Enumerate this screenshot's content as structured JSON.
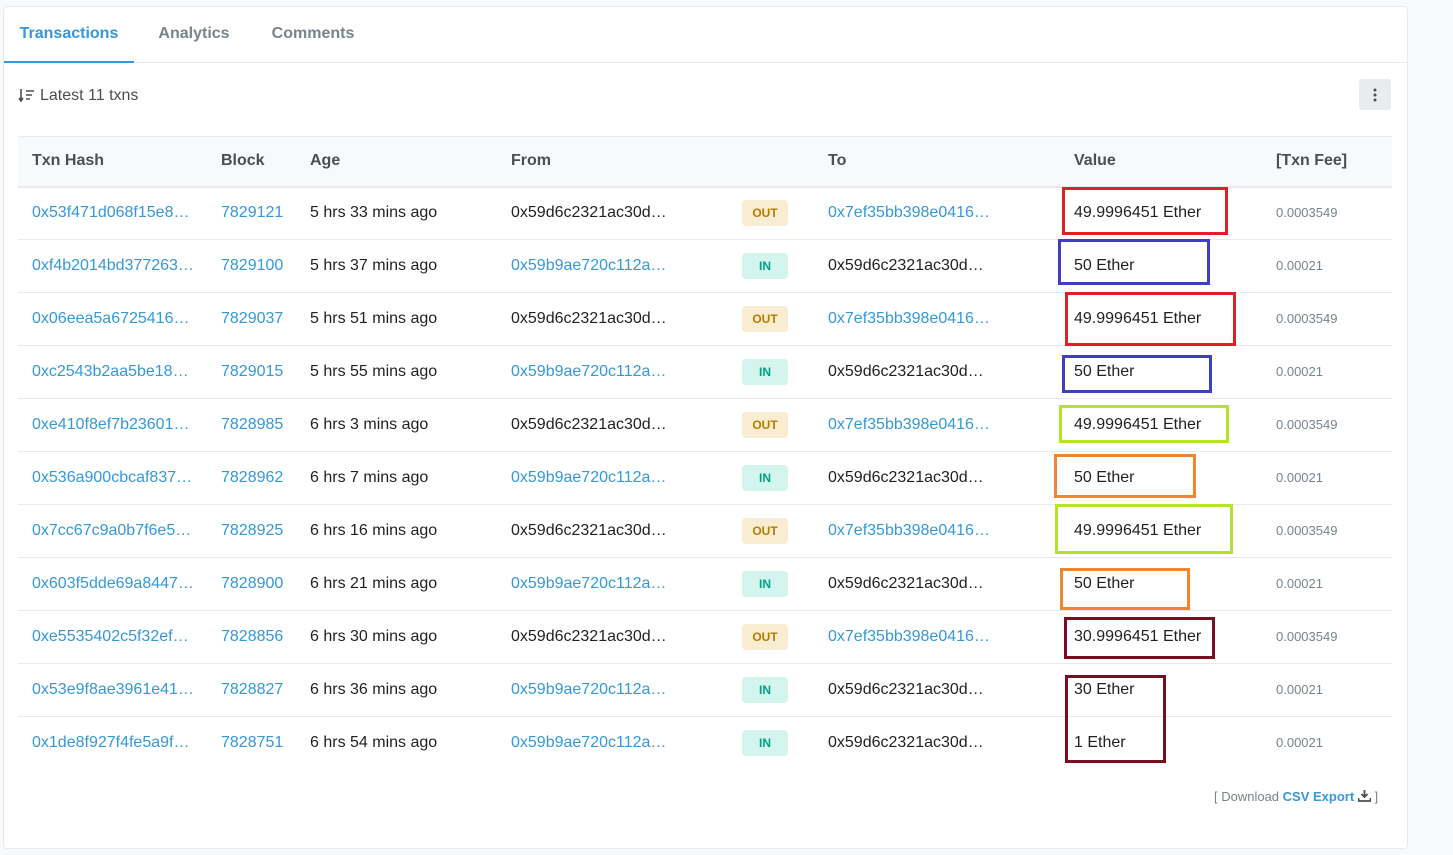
{
  "tabs": [
    {
      "label": "Transactions",
      "active": true
    },
    {
      "label": "Analytics",
      "active": false
    },
    {
      "label": "Comments",
      "active": false
    }
  ],
  "summary": {
    "latest_label": "Latest 11 txns"
  },
  "columns": [
    "Txn Hash",
    "Block",
    "Age",
    "From",
    "",
    "To",
    "Value",
    "[Txn Fee]"
  ],
  "rows": [
    {
      "hash": "0x53f471d068f15e8…",
      "block": "7829121",
      "age": "5 hrs 33 mins ago",
      "from": "0x59d6c2321ac30d…",
      "from_link": false,
      "dir": "OUT",
      "to": "0x7ef35bb398e0416…",
      "to_link": true,
      "value": "49.9996451 Ether",
      "fee": "0.0003549"
    },
    {
      "hash": "0xf4b2014bd377263…",
      "block": "7829100",
      "age": "5 hrs 37 mins ago",
      "from": "0x59b9ae720c112a…",
      "from_link": true,
      "dir": "IN",
      "to": "0x59d6c2321ac30d…",
      "to_link": false,
      "value": "50 Ether",
      "fee": "0.00021"
    },
    {
      "hash": "0x06eea5a6725416…",
      "block": "7829037",
      "age": "5 hrs 51 mins ago",
      "from": "0x59d6c2321ac30d…",
      "from_link": false,
      "dir": "OUT",
      "to": "0x7ef35bb398e0416…",
      "to_link": true,
      "value": "49.9996451 Ether",
      "fee": "0.0003549"
    },
    {
      "hash": "0xc2543b2aa5be18…",
      "block": "7829015",
      "age": "5 hrs 55 mins ago",
      "from": "0x59b9ae720c112a…",
      "from_link": true,
      "dir": "IN",
      "to": "0x59d6c2321ac30d…",
      "to_link": false,
      "value": "50 Ether",
      "fee": "0.00021"
    },
    {
      "hash": "0xe410f8ef7b23601…",
      "block": "7828985",
      "age": "6 hrs 3 mins ago",
      "from": "0x59d6c2321ac30d…",
      "from_link": false,
      "dir": "OUT",
      "to": "0x7ef35bb398e0416…",
      "to_link": true,
      "value": "49.9996451 Ether",
      "fee": "0.0003549"
    },
    {
      "hash": "0x536a900cbcaf837…",
      "block": "7828962",
      "age": "6 hrs 7 mins ago",
      "from": "0x59b9ae720c112a…",
      "from_link": true,
      "dir": "IN",
      "to": "0x59d6c2321ac30d…",
      "to_link": false,
      "value": "50 Ether",
      "fee": "0.00021"
    },
    {
      "hash": "0x7cc67c9a0b7f6e5…",
      "block": "7828925",
      "age": "6 hrs 16 mins ago",
      "from": "0x59d6c2321ac30d…",
      "from_link": false,
      "dir": "OUT",
      "to": "0x7ef35bb398e0416…",
      "to_link": true,
      "value": "49.9996451 Ether",
      "fee": "0.0003549"
    },
    {
      "hash": "0x603f5dde69a8447…",
      "block": "7828900",
      "age": "6 hrs 21 mins ago",
      "from": "0x59b9ae720c112a…",
      "from_link": true,
      "dir": "IN",
      "to": "0x59d6c2321ac30d…",
      "to_link": false,
      "value": "50 Ether",
      "fee": "0.00021"
    },
    {
      "hash": "0xe5535402c5f32ef…",
      "block": "7828856",
      "age": "6 hrs 30 mins ago",
      "from": "0x59d6c2321ac30d…",
      "from_link": false,
      "dir": "OUT",
      "to": "0x7ef35bb398e0416…",
      "to_link": true,
      "value": "30.9996451 Ether",
      "fee": "0.0003549"
    },
    {
      "hash": "0x53e9f8ae3961e41…",
      "block": "7828827",
      "age": "6 hrs 36 mins ago",
      "from": "0x59b9ae720c112a…",
      "from_link": true,
      "dir": "IN",
      "to": "0x59d6c2321ac30d…",
      "to_link": false,
      "value": "30 Ether",
      "fee": "0.00021"
    },
    {
      "hash": "0x1de8f927f4fe5a9f…",
      "block": "7828751",
      "age": "6 hrs 54 mins ago",
      "from": "0x59b9ae720c112a…",
      "from_link": true,
      "dir": "IN",
      "to": "0x59d6c2321ac30d…",
      "to_link": false,
      "value": "1 Ether",
      "fee": "0.00021"
    }
  ],
  "highlight_colors": [
    "#e02027",
    "#3f3fc1",
    "#e02027",
    "#3f3fc1",
    "#b5e32b",
    "#f5852a",
    "#b5e32b",
    "#f5852a",
    "#7a0d1f",
    "#7a0d1f"
  ],
  "footer": {
    "prefix": "[ Download",
    "link": "CSV Export",
    "suffix": "]"
  }
}
